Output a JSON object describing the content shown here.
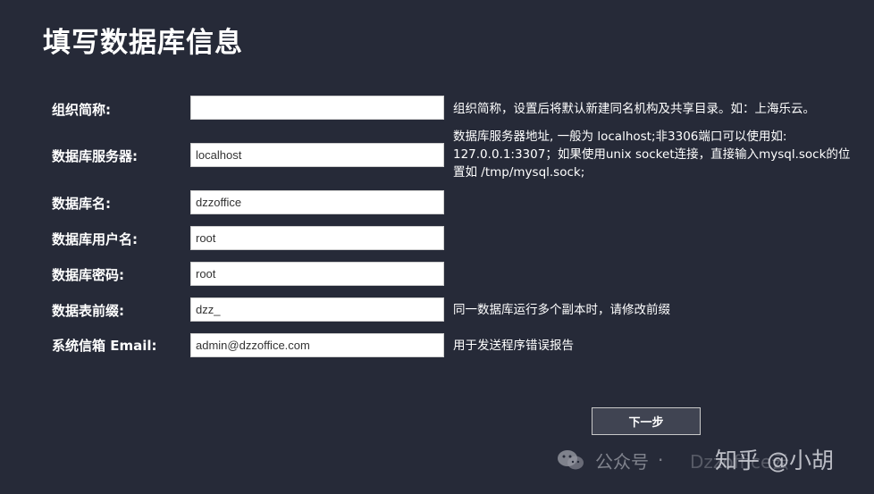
{
  "page": {
    "title": "填写数据库信息"
  },
  "form": {
    "fields": [
      {
        "label": "组织简称:",
        "value": "",
        "help": "组织简称，设置后将默认新建同名机构及共享目录。如：上海乐云。"
      },
      {
        "label": "数据库服务器:",
        "value": "localhost",
        "help": "数据库服务器地址, 一般为 localhost;非3306端口可以使用如: 127.0.0.1:3307；如果使用unix socket连接，直接输入mysql.sock的位置如 /tmp/mysql.sock;"
      },
      {
        "label": "数据库名:",
        "value": "dzzoffice",
        "help": ""
      },
      {
        "label": "数据库用户名:",
        "value": "root",
        "help": ""
      },
      {
        "label": "数据库密码:",
        "value": "root",
        "help": ""
      },
      {
        "label": "数据表前缀:",
        "value": "dzz_",
        "help": "同一数据库运行多个副本时，请修改前缀"
      },
      {
        "label": "系统信箱 Email:",
        "value": "admin@dzzoffice.com",
        "help": "用于发送程序错误报告"
      }
    ],
    "next_label": "下一步"
  },
  "watermark": {
    "account": "公众号",
    "separator": "·",
    "owner": "Dzzoffice云",
    "brand": "知乎 @小胡",
    "icon": "wechat-icon"
  }
}
